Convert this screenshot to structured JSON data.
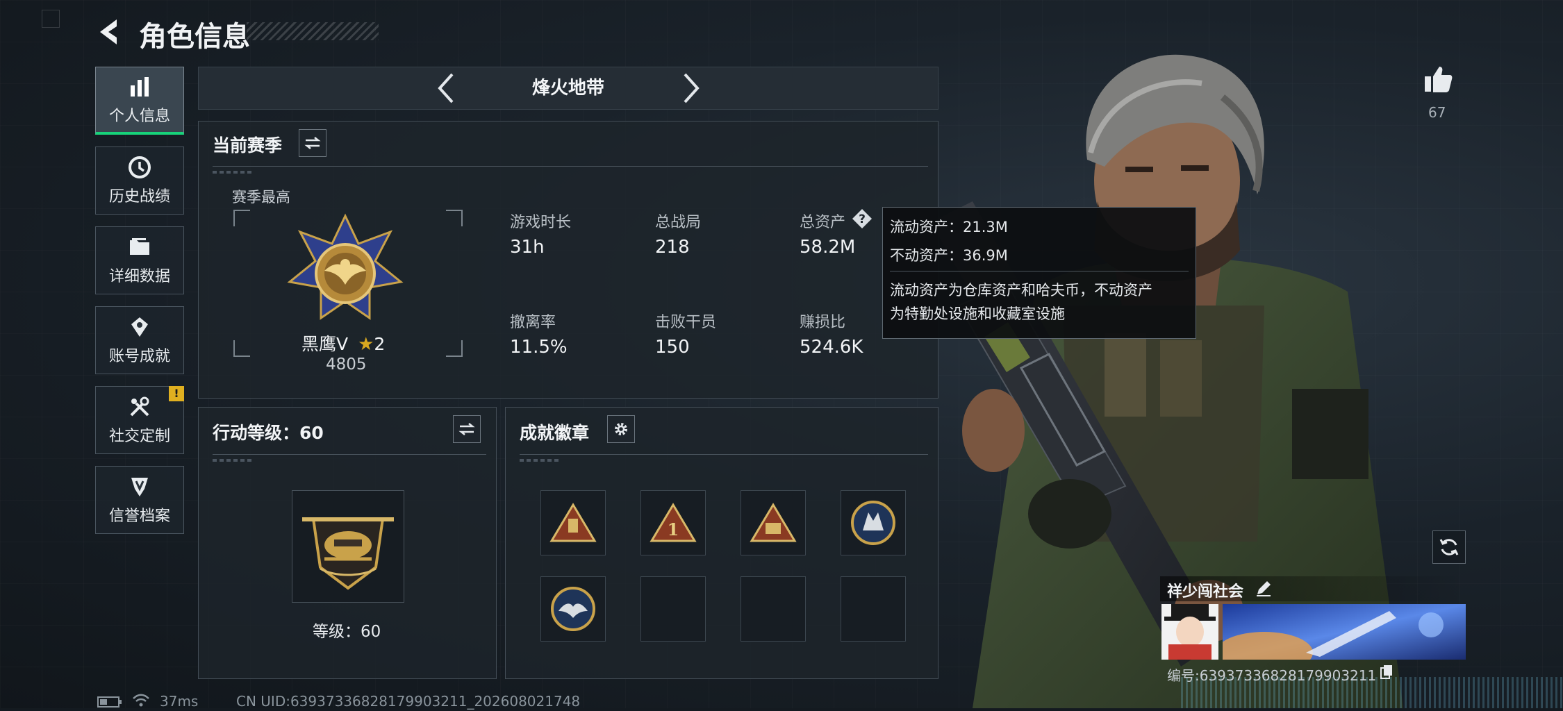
{
  "page": {
    "title": "角色信息",
    "mode": "烽火地带"
  },
  "sidebar": {
    "items": [
      {
        "label": "个人信息",
        "icon": "bar-chart-icon",
        "active": true
      },
      {
        "label": "历史战绩",
        "icon": "history-icon",
        "active": false
      },
      {
        "label": "详细数据",
        "icon": "folder-icon",
        "active": false
      },
      {
        "label": "账号成就",
        "icon": "achievement-icon",
        "active": false
      },
      {
        "label": "社交定制",
        "icon": "tools-icon",
        "active": false,
        "alert": "!"
      },
      {
        "label": "信誉档案",
        "icon": "shield-icon",
        "active": false
      }
    ]
  },
  "season": {
    "heading": "当前赛季",
    "best_label": "赛季最高",
    "rank_name": "黑鹰V",
    "rank_stars": "2",
    "rank_score": "4805",
    "stats": [
      {
        "label": "游戏时长",
        "value": "31h"
      },
      {
        "label": "总战局",
        "value": "218"
      },
      {
        "label": "总资产",
        "value": "58.2M"
      },
      {
        "label": "撤离率",
        "value": "11.5%"
      },
      {
        "label": "击败干员",
        "value": "150"
      },
      {
        "label": "赚损比",
        "value": "524.6K"
      }
    ]
  },
  "tooltip": {
    "liquid": "流动资产：21.3M",
    "fixed": "不动资产：36.9M",
    "desc_line1": "流动资产为仓库资产和哈夫币，不动资产",
    "desc_line2": "为特勤处设施和收藏室设施"
  },
  "action_level": {
    "heading": "行动等级：60",
    "level_text": "等级：60"
  },
  "achievements": {
    "heading": "成就徽章"
  },
  "profile": {
    "likes": "67",
    "player_name": "祥少闯社会",
    "id_text": "编号:639373368281799032​11"
  },
  "status": {
    "ping": "37ms",
    "uid": "CN UID:6393733682817990​3211_202608021748"
  },
  "colors": {
    "accent_green": "#17d37a",
    "alert_yellow": "#e0b020",
    "gold": "#c9a24a"
  }
}
